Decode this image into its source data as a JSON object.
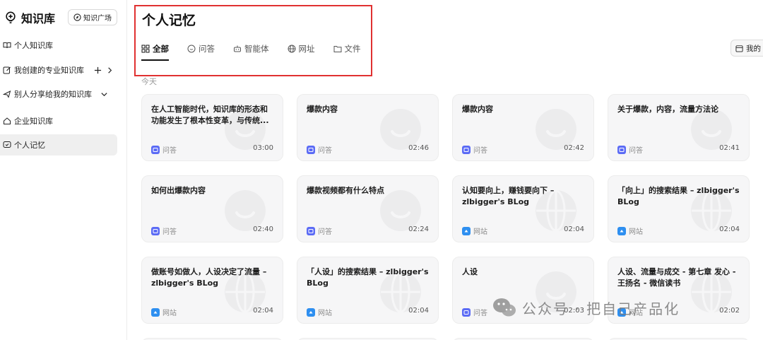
{
  "sidebar": {
    "brand": "知识库",
    "plaza_button": "知识广场",
    "items": [
      {
        "label": "个人知识库",
        "icon": "book-icon"
      },
      {
        "label": "我创建的专业知识库",
        "icon": "edit-icon"
      },
      {
        "label": "别人分享给我的知识库",
        "icon": "share-icon"
      },
      {
        "label": "企业知识库",
        "icon": "home-icon"
      },
      {
        "label": "个人记忆",
        "icon": "memory-icon"
      }
    ]
  },
  "main": {
    "title": "个人记忆",
    "tabs": [
      {
        "label": "全部",
        "icon": "grid-icon"
      },
      {
        "label": "问答",
        "icon": "chat-icon"
      },
      {
        "label": "智能体",
        "icon": "robot-icon"
      },
      {
        "label": "网址",
        "icon": "globe-icon"
      },
      {
        "label": "文件",
        "icon": "folder-icon"
      }
    ],
    "right_button": "我的",
    "section_label": "今天",
    "cards": [
      {
        "title": "在人工智能时代，知识库的形态和功能发生了根本性变革，与传统...",
        "type": "问答",
        "kind": "qa",
        "time": "03:00"
      },
      {
        "title": "爆款内容",
        "type": "问答",
        "kind": "qa",
        "time": "02:46"
      },
      {
        "title": "爆款内容",
        "type": "问答",
        "kind": "qa",
        "time": "02:42"
      },
      {
        "title": "关于爆款，内容，流量方法论",
        "type": "问答",
        "kind": "qa",
        "time": "02:41"
      },
      {
        "title": "如何出爆款内容",
        "type": "问答",
        "kind": "qa",
        "time": "02:40"
      },
      {
        "title": "爆款视频都有什么特点",
        "type": "问答",
        "kind": "qa",
        "time": "02:24"
      },
      {
        "title": "认知要向上，赚钱要向下 – zlbigger's BLog",
        "type": "网站",
        "kind": "web",
        "time": "02:04"
      },
      {
        "title": "「向上」的搜索结果 – zlbigger's BLog",
        "type": "网站",
        "kind": "web",
        "time": "02:04"
      },
      {
        "title": "做账号如做人，人设决定了流量 – zlbigger's BLog",
        "type": "网站",
        "kind": "web",
        "time": "02:04"
      },
      {
        "title": "「人设」的搜索结果 – zlbigger's BLog",
        "type": "网站",
        "kind": "web",
        "time": "02:04"
      },
      {
        "title": "人设",
        "type": "问答",
        "kind": "qa",
        "time": "02:03"
      },
      {
        "title": "人设、流量与成交 - 第七章 发心 - 王扬名 - 微信读书",
        "type": "网站",
        "kind": "web",
        "time": "02:02"
      }
    ]
  },
  "watermark": {
    "text": "公众号 · 把自己产品化"
  },
  "colors": {
    "highlight": "#e03131",
    "qa_icon": "#5b6bf5",
    "web_icon": "#2e8ff0",
    "card_bg": "#f6f6f7"
  }
}
